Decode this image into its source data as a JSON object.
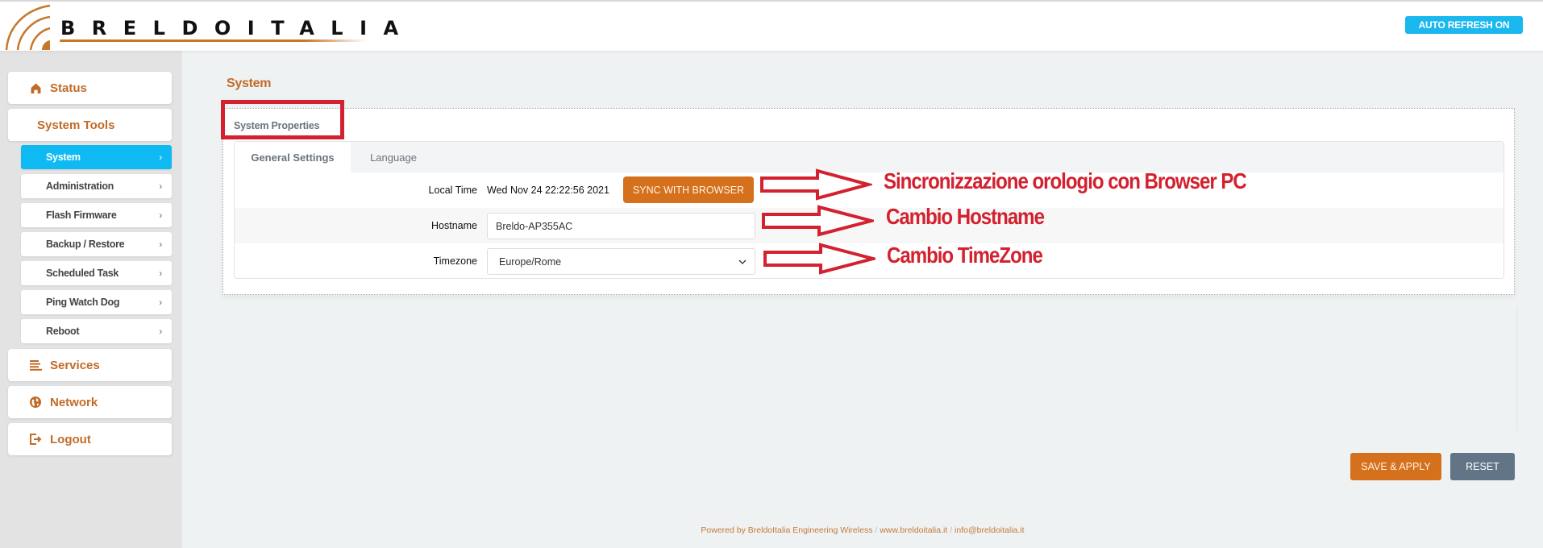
{
  "header": {
    "brand": "BRELDOITALIA",
    "auto_refresh_label": "AUTO REFRESH ON"
  },
  "colors": {
    "brand_orange": "#c26b28",
    "accent_blue": "#0fbaf3",
    "button_orange": "#d5701d",
    "button_gray": "#627587",
    "annotation_red": "#d3212f"
  },
  "sidebar": {
    "items": [
      {
        "label": "Status",
        "icon": "home-icon"
      },
      {
        "label": "System Tools"
      },
      {
        "label": "Services",
        "icon": "list-icon"
      },
      {
        "label": "Network",
        "icon": "globe-icon"
      },
      {
        "label": "Logout",
        "icon": "logout-icon"
      }
    ],
    "subitems": [
      {
        "label": "System",
        "active": true
      },
      {
        "label": "Administration"
      },
      {
        "label": "Flash Firmware"
      },
      {
        "label": "Backup / Restore"
      },
      {
        "label": "Scheduled Task"
      },
      {
        "label": "Ping Watch Dog"
      },
      {
        "label": "Reboot"
      }
    ],
    "chevron": "›"
  },
  "main": {
    "title": "System",
    "panel_title": "System Properties",
    "tabs": [
      {
        "label": "General Settings",
        "active": true
      },
      {
        "label": "Language"
      }
    ],
    "fields": {
      "local_time": {
        "label": "Local Time",
        "value": "Wed Nov 24 22:22:56 2021",
        "button": "SYNC WITH BROWSER"
      },
      "hostname": {
        "label": "Hostname",
        "value": "Breldo-AP355AC"
      },
      "timezone": {
        "label": "Timezone",
        "value": "Europe/Rome"
      }
    },
    "save_label": "SAVE & APPLY",
    "reset_label": "RESET"
  },
  "annotations": [
    "Sincronizzazione orologio con Browser PC",
    "Cambio Hostname",
    "Cambio TimeZone"
  ],
  "footer": {
    "powered": "Powered by BreldoItalia Engineering Wireless",
    "sep": "/",
    "website": "www.breldoitalia.it",
    "email": "info@breldoitalia.it"
  }
}
